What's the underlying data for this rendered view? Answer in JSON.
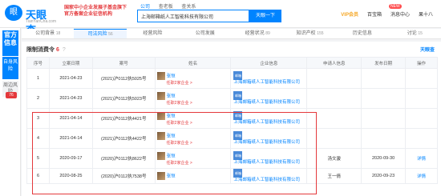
{
  "header": {
    "logo_text": "天眼查",
    "logo_sub": "TianYanCha.com",
    "logo_mark": "眼",
    "promo_line1": "国家中小企业发展子基金旗下",
    "promo_line2": "官方备案企业征信机构",
    "search_tabs": [
      "公司",
      "查老板",
      "查关系"
    ],
    "search_value": "上海邮箱纸人工智能科技有限公司",
    "search_button": "天眼一下",
    "nav": [
      "VIP会员",
      "百宝箱",
      "消息中心",
      "果十八"
    ],
    "new_badge": "NEW"
  },
  "side": {
    "official": "官方信息",
    "self_risk": "自身风险",
    "surround": "周边风险",
    "risk_count": "76"
  },
  "tabs": [
    {
      "label": "公司背景",
      "count": "18",
      "active": false
    },
    {
      "label": "司法风险",
      "count": "56",
      "active": true
    },
    {
      "label": "经营风险",
      "count": "",
      "active": false
    },
    {
      "label": "公司发展",
      "count": "",
      "active": false
    },
    {
      "label": "经营状况",
      "count": "89",
      "active": false
    },
    {
      "label": "知识产权",
      "count": "155",
      "active": false
    },
    {
      "label": "历史信息",
      "count": "",
      "active": false
    },
    {
      "label": "讨论",
      "count": "15",
      "active": false
    }
  ],
  "panel": {
    "title": "限制消费令",
    "count": "6",
    "brand": "天眼查"
  },
  "columns": [
    "序号",
    "立案日期",
    "案号",
    "姓名",
    "企业信息",
    "申请人信息",
    "发布日期",
    "操作"
  ],
  "rows": [
    {
      "no": "1",
      "date": "2021-04-23",
      "case": "(2021)沪0112执5025号",
      "person": "张恒",
      "person_sub": "任职2家企业 >",
      "company": "上海邮箱纸人工智能科技有限公司",
      "applicant": "",
      "pub": "",
      "op": ""
    },
    {
      "no": "2",
      "date": "2021-04-23",
      "case": "(2021)沪0112执5023号",
      "person": "张恒",
      "person_sub": "任职2家企业 >",
      "company": "上海邮箱纸人工智能科技有限公司",
      "applicant": "",
      "pub": "",
      "op": ""
    },
    {
      "no": "3",
      "date": "2021-04-14",
      "case": "(2021)沪0112执4421号",
      "person": "张恒",
      "person_sub": "任职2家企业 >",
      "company": "上海邮箱纸人工智能科技有限公司",
      "applicant": "",
      "pub": "",
      "op": ""
    },
    {
      "no": "4",
      "date": "2021-04-14",
      "case": "(2021)沪0112执4422号",
      "person": "张恒",
      "person_sub": "任职2家企业 >",
      "company": "上海邮箱纸人工智能科技有限公司",
      "applicant": "",
      "pub": "",
      "op": ""
    },
    {
      "no": "5",
      "date": "2020-09-17",
      "case": "(2020)沪0112执8622号",
      "person": "张恒",
      "person_sub": "任职2家企业 >",
      "company": "上海邮箱纸人工智能科技有限公司",
      "applicant": "汤文骏",
      "pub": "2020-09-30",
      "op": "详情"
    },
    {
      "no": "6",
      "date": "2020-08-25",
      "case": "(2020)沪0112执7538号",
      "person": "张恒",
      "person_sub": "",
      "company": "上海邮箱纸人工智能科技有限公司",
      "applicant": "王一倩",
      "pub": "2020-09-23",
      "op": "详情"
    }
  ]
}
